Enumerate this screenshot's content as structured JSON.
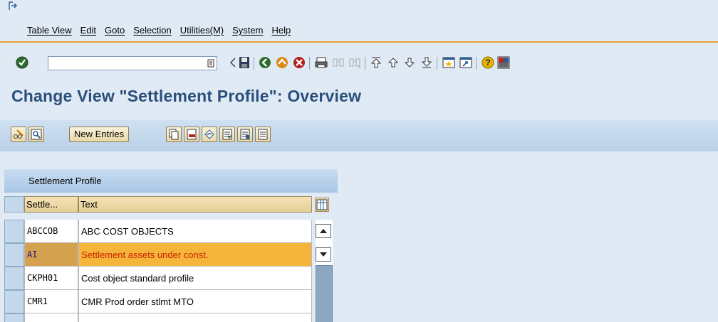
{
  "menu": {
    "items": [
      "Table View",
      "Edit",
      "Goto",
      "Selection",
      "Utilities(M)",
      "System",
      "Help"
    ]
  },
  "command_field": {
    "value": ""
  },
  "title": "Change View \"Settlement Profile\": Overview",
  "app_toolbar": {
    "new_entries_label": "New Entries"
  },
  "table": {
    "title": "Settlement Profile",
    "columns": [
      "Settle...",
      "Text"
    ],
    "rows": [
      {
        "key": "ABCCOB",
        "text": "ABC COST OBJECTS",
        "selected": false
      },
      {
        "key": "AI",
        "text": "Settlement assets under const.",
        "selected": true
      },
      {
        "key": "CKPH01",
        "text": "Cost object standard profile",
        "selected": false
      },
      {
        "key": "CMR1",
        "text": "CMR Prod order stlmt MTO",
        "selected": false
      }
    ]
  },
  "colors": {
    "accent_orange": "#e8a23a",
    "title_blue": "#2a4f7a",
    "selected_row": "#f5b53a",
    "selected_text": "#cc2200"
  }
}
